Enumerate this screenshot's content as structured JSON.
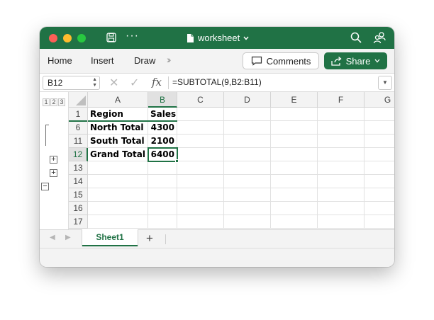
{
  "window": {
    "title": "worksheet"
  },
  "ribbon": {
    "tabs": [
      "Home",
      "Insert",
      "Draw"
    ],
    "comments_label": "Comments",
    "share_label": "Share"
  },
  "formula_bar": {
    "name_box": "B12",
    "formula": "=SUBTOTAL(9,B2:B11)"
  },
  "outline": {
    "levels": [
      "1",
      "2",
      "3"
    ]
  },
  "grid": {
    "columns": [
      "A",
      "B",
      "C",
      "D",
      "E",
      "F",
      "G"
    ],
    "selected_column": "B",
    "rows": [
      {
        "num": "1",
        "cells": [
          "Region",
          "Sales"
        ]
      },
      {
        "num": "6",
        "cells": [
          "North Total",
          "4300"
        ]
      },
      {
        "num": "11",
        "cells": [
          "South Total",
          "2100"
        ]
      },
      {
        "num": "12",
        "cells": [
          "Grand Total",
          "6400"
        ]
      },
      {
        "num": "13",
        "cells": [
          "",
          ""
        ]
      },
      {
        "num": "14",
        "cells": [
          "",
          ""
        ]
      },
      {
        "num": "15",
        "cells": [
          "",
          ""
        ]
      },
      {
        "num": "16",
        "cells": [
          "",
          ""
        ]
      },
      {
        "num": "17",
        "cells": [
          "",
          ""
        ]
      }
    ],
    "selected_cell": "B12"
  },
  "sheets": {
    "tabs": [
      "Sheet1"
    ],
    "active": "Sheet1"
  },
  "colors": {
    "accent": "#207245",
    "titlebar": "#207245"
  }
}
